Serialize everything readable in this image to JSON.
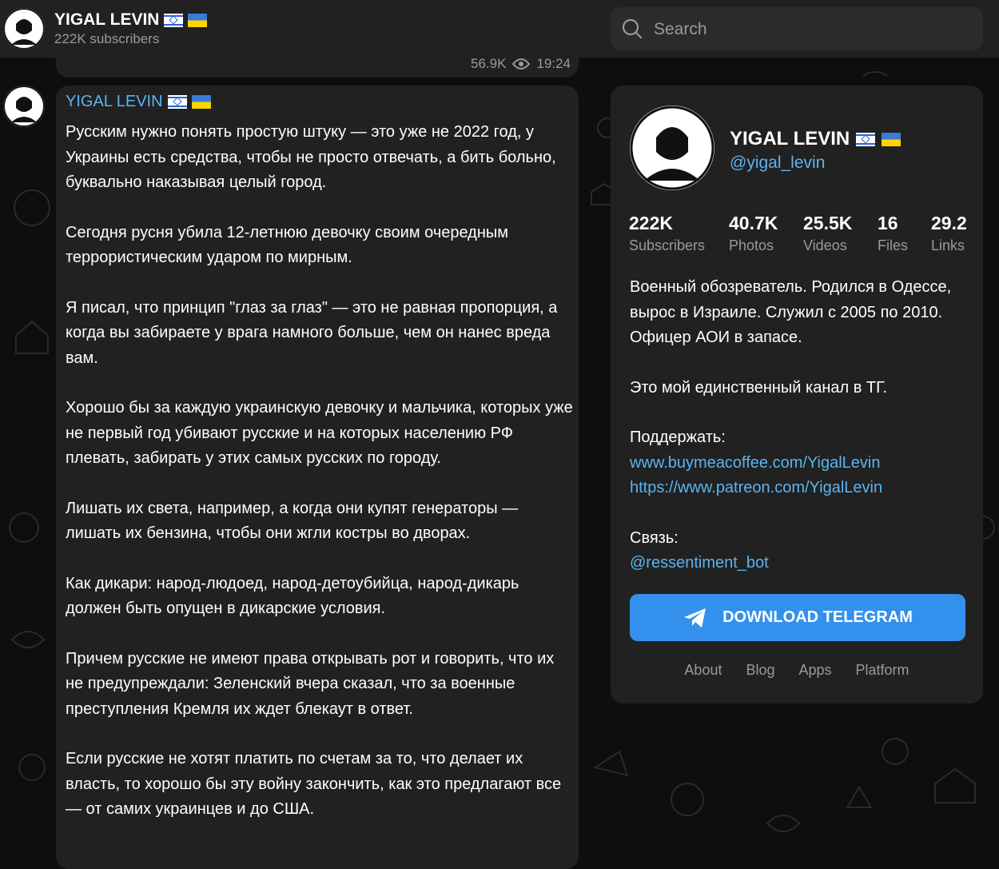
{
  "header": {
    "title": "YIGAL LEVIN",
    "subscribers": "222K subscribers",
    "search_placeholder": "Search"
  },
  "prev_message": {
    "views": "56.9K",
    "time": "19:24"
  },
  "message": {
    "author": "YIGAL LEVIN",
    "paragraphs": [
      "Русским нужно понять простую штуку — это уже не 2022 год, у Украины есть средства, чтобы не просто отвечать, а бить больно, буквально наказывая целый город.",
      "Сегодня русня убила 12-летнюю девочку своим очередным террористическим ударом по мирным.",
      "Я писал, что принцип \"глаз за глаз\" — это не равная пропорция, а когда вы забираете у врага намного больше, чем он нанес вреда вам.",
      "Хорошо бы за каждую украинскую девочку и мальчика, которых уже не первый год убивают русские и на которых населению РФ плевать, забирать у этих самых русских по городу.",
      "Лишать их света, например, а когда они купят генераторы — лишать их бензина, чтобы они жгли костры во дворах.",
      "Как дикари: народ-людоед, народ-детоубийца, народ-дикарь должен быть опущен в дикарские условия.",
      "Причем русские не имеют права открывать рот и говорить, что их не предупреждали: Зеленский вчера сказал, что за военные преступления Кремля их ждет блекаут в ответ.",
      "Если русские не хотят платить по счетам за то, что делает их власть, то хорошо бы эту войну закончить, как это предлагают все — от самих украинцев и до США."
    ]
  },
  "card": {
    "name": "YIGAL LEVIN",
    "handle": "@yigal_levin",
    "stats": [
      {
        "value": "222K",
        "label": "Subscribers"
      },
      {
        "value": "40.7K",
        "label": "Photos"
      },
      {
        "value": "25.5K",
        "label": "Videos"
      },
      {
        "value": "16",
        "label": "Files"
      },
      {
        "value": "29.2",
        "label": "Links"
      }
    ],
    "description": {
      "bio": "Военный обозреватель. Родился в Одессе, вырос в Израиле. Служил с 2005 по 2010. Офицер АОИ в запасе.",
      "only_channel": "Это мой единственный канал в ТГ.",
      "support_label": "Поддержать:",
      "support_link_1": "www.buymeacoffee.com/YigalLevin",
      "support_link_2": "https://www.patreon.com/YigalLevin",
      "contact_label": "Связь:",
      "contact_link": "@ressentiment_bot"
    },
    "download_label": "DOWNLOAD TELEGRAM",
    "footer_links": [
      "About",
      "Blog",
      "Apps",
      "Platform"
    ]
  },
  "colors": {
    "background": "#0e0e0e",
    "panel": "#212121",
    "accent": "#5bb4f0",
    "button": "#3390ec",
    "muted": "#9a9a9a"
  }
}
